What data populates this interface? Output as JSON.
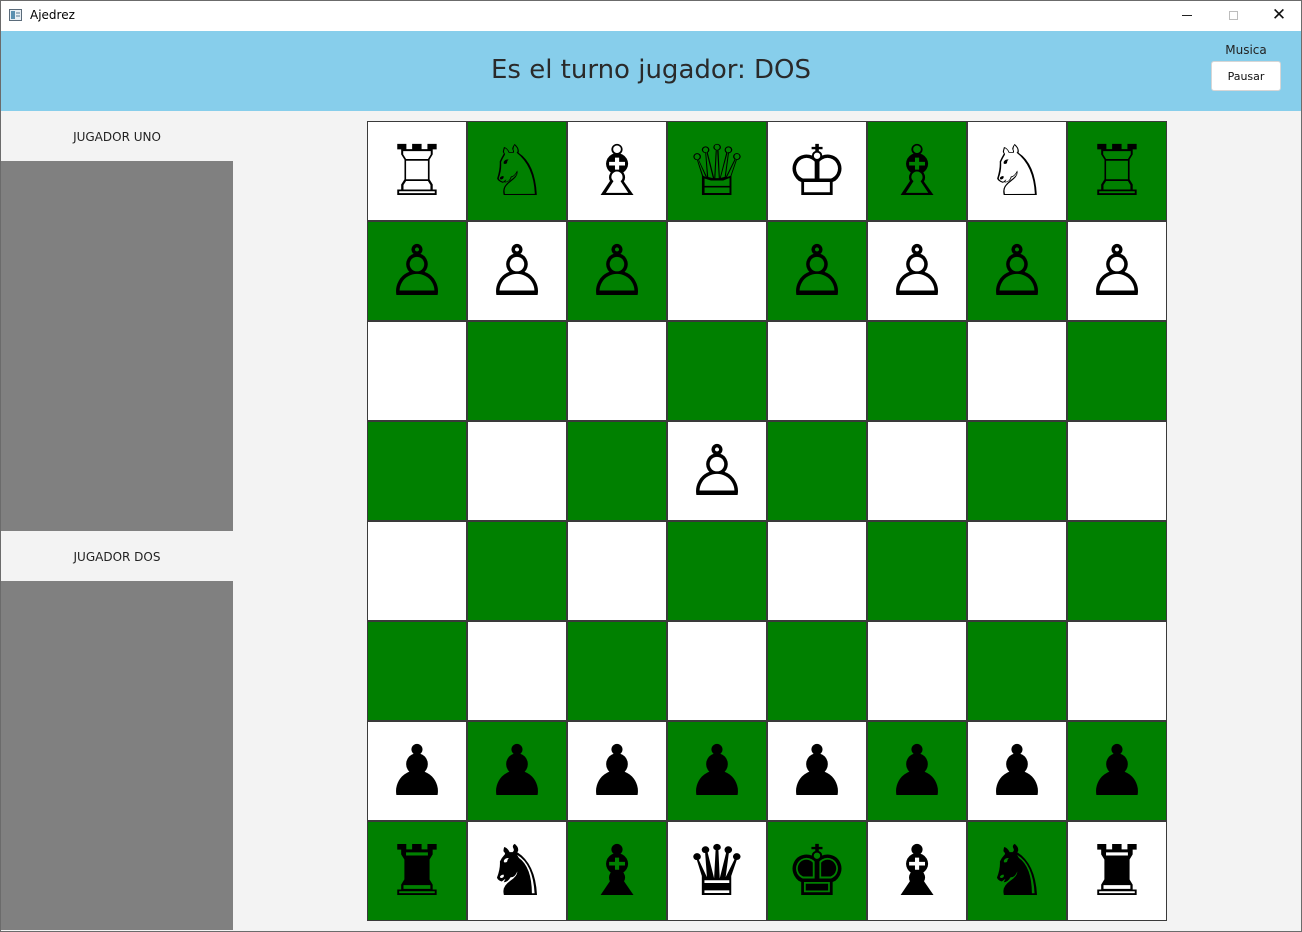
{
  "window": {
    "title": "Ajedrez"
  },
  "header": {
    "turn_text": "Es el turno jugador: DOS",
    "music_label": "Musica",
    "pause_label": "Pausar",
    "background": "#87ceeb"
  },
  "players": {
    "uno": "JUGADOR UNO",
    "dos": "JUGADOR DOS"
  },
  "board": {
    "light_color": "#ffffff",
    "dark_color": "#008000",
    "rows": [
      [
        "♖",
        "♘",
        "♗",
        "♕",
        "♔",
        "♗",
        "♘",
        "♖"
      ],
      [
        "♙",
        "♙",
        "♙",
        "",
        "♙",
        "♙",
        "♙",
        "♙"
      ],
      [
        "",
        "",
        "",
        "",
        "",
        "",
        "",
        ""
      ],
      [
        "",
        "",
        "",
        "♙",
        "",
        "",
        "",
        ""
      ],
      [
        "",
        "",
        "",
        "",
        "",
        "",
        "",
        ""
      ],
      [
        "",
        "",
        "",
        "",
        "",
        "",
        "",
        ""
      ],
      [
        "♟",
        "♟",
        "♟",
        "♟",
        "♟",
        "♟",
        "♟",
        "♟"
      ],
      [
        "♜",
        "♞",
        "♝",
        "♛",
        "♚",
        "♝",
        "♞",
        "♜"
      ]
    ]
  }
}
